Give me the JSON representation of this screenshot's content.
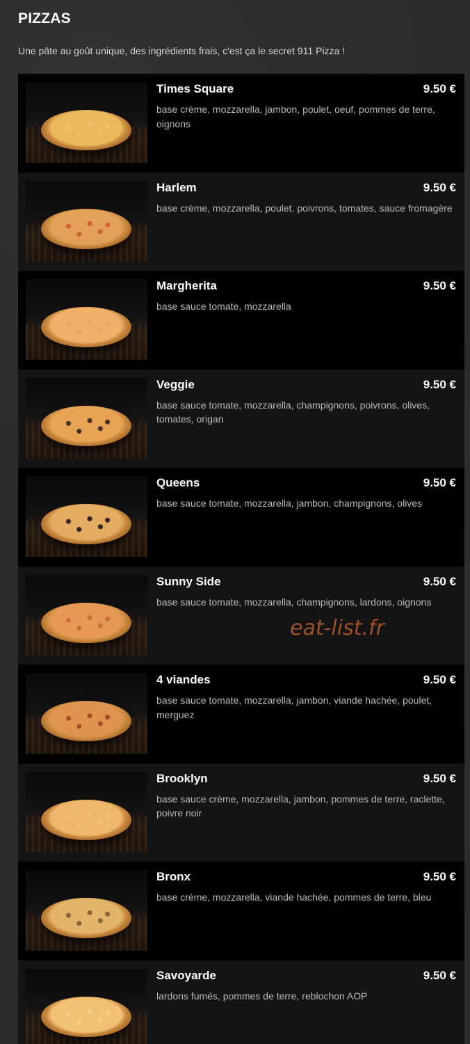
{
  "header": {
    "title": "PIZZAS",
    "subtitle": "Une pâte au goût unique, des ingrédients frais, c'est ça le secret 911 Pizza !"
  },
  "watermark": "eat-list.fr",
  "items": [
    {
      "name": "Times Square",
      "price": "9.50 €",
      "description": "base crème, mozzarella, jambon, poulet, oeuf, pommes de terre, oignons"
    },
    {
      "name": "Harlem",
      "price": "9.50 €",
      "description": "base crème, mozzarella, poulet, poivrons, tomates, sauce fromagère"
    },
    {
      "name": "Margherita",
      "price": "9.50 €",
      "description": "base sauce tomate, mozzarella"
    },
    {
      "name": "Veggie",
      "price": "9.50 €",
      "description": "base sauce tomate, mozzarella, champignons, poivrons, olives, tomates, origan"
    },
    {
      "name": "Queens",
      "price": "9.50 €",
      "description": "base sauce tomate, mozzarella, jambon, champignons, olives"
    },
    {
      "name": "Sunny Side",
      "price": "9.50 €",
      "description": "base sauce tomate, mozzarella, champignons, lardons, oignons"
    },
    {
      "name": "4 viandes",
      "price": "9.50 €",
      "description": "base sauce tomate, mozzarella, jambon, viande hachée, poulet, merguez"
    },
    {
      "name": "Brooklyn",
      "price": "9.50 €",
      "description": "base sauce crème, mozzarella, jambon, pommes de terre, raclette, poivre noir"
    },
    {
      "name": "Bronx",
      "price": "9.50 €",
      "description": "base crème, mozzarella, viande hachée, pommes de terre, bleu"
    },
    {
      "name": "Savoyarde",
      "price": "9.50 €",
      "description": "lardons fumés, pommes de terre, reblochon AOP"
    }
  ]
}
